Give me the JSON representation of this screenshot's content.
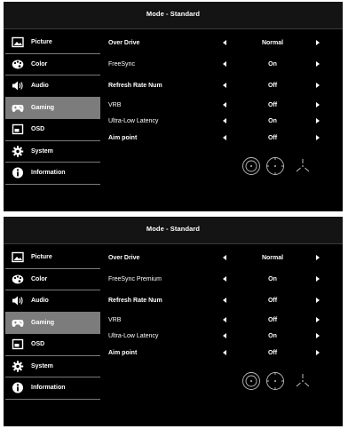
{
  "panels": [
    {
      "title": "Mode - Standard",
      "sidebar": [
        {
          "label": "Picture",
          "icon": "picture-icon",
          "active": false
        },
        {
          "label": "Color",
          "icon": "palette-icon",
          "active": false
        },
        {
          "label": "Audio",
          "icon": "speaker-icon",
          "active": false
        },
        {
          "label": "Gaming",
          "icon": "gamepad-icon",
          "active": true
        },
        {
          "label": "OSD",
          "icon": "osd-icon",
          "active": false
        },
        {
          "label": "System",
          "icon": "gear-icon",
          "active": false
        },
        {
          "label": "Information",
          "icon": "info-icon",
          "active": false
        }
      ],
      "settings": [
        {
          "name": "Over Drive",
          "value": "Normal"
        },
        {
          "name": "FreeSync",
          "value": "On"
        },
        {
          "name": "Refresh Rate Num",
          "value": "Off"
        },
        {
          "name": "VRB",
          "value": "Off"
        },
        {
          "name": "Ultra-Low Latency",
          "value": "On"
        },
        {
          "name": "Aim point",
          "value": "Off"
        }
      ]
    },
    {
      "title": "Mode - Standard",
      "sidebar": [
        {
          "label": "Picture",
          "icon": "picture-icon",
          "active": false
        },
        {
          "label": "Color",
          "icon": "palette-icon",
          "active": false
        },
        {
          "label": "Audio",
          "icon": "speaker-icon",
          "active": false
        },
        {
          "label": "Gaming",
          "icon": "gamepad-icon",
          "active": true
        },
        {
          "label": "OSD",
          "icon": "osd-icon",
          "active": false
        },
        {
          "label": "System",
          "icon": "gear-icon",
          "active": false
        },
        {
          "label": "Information",
          "icon": "info-icon",
          "active": false
        }
      ],
      "settings": [
        {
          "name": "Over Drive",
          "value": "Normal"
        },
        {
          "name": "FreeSync Premium",
          "value": "On"
        },
        {
          "name": "Refresh Rate Num",
          "value": "Off"
        },
        {
          "name": "VRB",
          "value": "Off"
        },
        {
          "name": "Ultra-Low Latency",
          "value": "On"
        },
        {
          "name": "Aim point",
          "value": "Off"
        }
      ]
    }
  ],
  "colors": {
    "background": "#000000",
    "active_item": "#7c7c7c",
    "text": "#ffffff"
  }
}
